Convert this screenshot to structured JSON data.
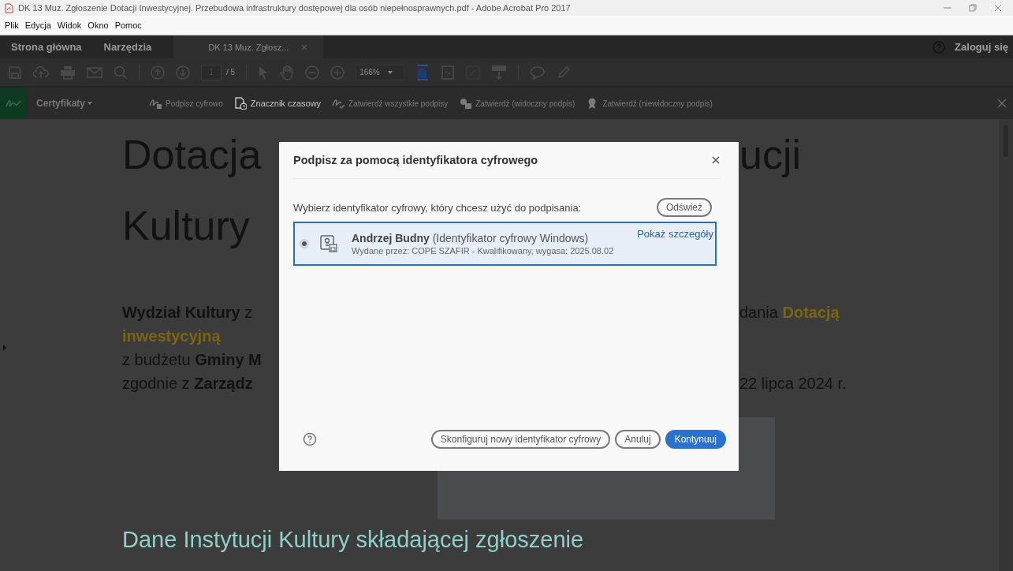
{
  "window": {
    "title": "DK 13 Muz. Zgłoszenie Dotacji Inwestycyjnej. Przebudowa infrastruktury dostępowej dla osób niepełnosprawnych.pdf - Adobe Acrobat Pro 2017"
  },
  "menu": [
    {
      "label": "Plik"
    },
    {
      "label": "Edycja"
    },
    {
      "label": "Widok"
    },
    {
      "label": "Okno"
    },
    {
      "label": "Pomoc"
    }
  ],
  "tabs": [
    {
      "label": "Strona główna",
      "selected": false
    },
    {
      "label": "Narzędzia",
      "selected": false
    },
    {
      "label": "DK 13 Muz. Zgłosz...",
      "selected": true
    }
  ],
  "sign_in": "Zaloguj się",
  "toolbar": {
    "page": "1",
    "page_total": "/ 5",
    "zoom": "166%"
  },
  "cert_toolbar": {
    "title": "Certyfikaty",
    "items": [
      {
        "label": "Podpisz cyfrowo",
        "disabled": true
      },
      {
        "label": "Znacznik czasowy",
        "disabled": false
      },
      {
        "label": "Zatwierdź wszystkie podpisy",
        "disabled": true
      },
      {
        "label": "Zatwierdź (widoczny podpis)",
        "disabled": true
      },
      {
        "label": "Zatwierdź (niewidoczny podpis)",
        "disabled": true
      }
    ]
  },
  "document": {
    "title_lines": [
      {
        "left": "Dotacja",
        "right": "ucji"
      },
      {
        "left": "Kultury"
      }
    ],
    "paragraph_lines": [
      {
        "left": [
          {
            "text": "Wydział Kultury",
            "kind": "bold"
          },
          {
            "text": " z",
            "kind": "plain"
          }
        ],
        "right": [
          {
            "text": "dania ",
            "kind": "plain"
          },
          {
            "text": "Dotacją",
            "kind": "accent"
          }
        ]
      },
      {
        "left": [
          {
            "text": "inwestycyjną",
            "kind": "accent"
          }
        ]
      },
      {
        "left": [
          {
            "text": "z budżetu ",
            "kind": "plain"
          },
          {
            "text": "Gminy M",
            "kind": "bold"
          }
        ]
      },
      {
        "left": [
          {
            "text": "zgodnie z ",
            "kind": "plain"
          },
          {
            "text": "Zarządz",
            "kind": "bold"
          }
        ],
        "right": [
          {
            "text": "22 lipca 2024 r.",
            "kind": "plain"
          }
        ]
      }
    ],
    "section_heading": "Dane Instytucji Kultury składającej zgłoszenie"
  },
  "dialog": {
    "title": "Podpisz za pomocą identyfikatora cyfrowego",
    "prompt": "Wybierz identyfikator cyfrowy, który chcesz użyć do podpisania:",
    "refresh": "Odśwież",
    "identities": [
      {
        "name": "**Andrzej Budny** (Identyfikator cyfrowy Windows)",
        "issuer": "Wydane przez: COPE SZAFIR - Kwalifikowany, wygasa: 2025.08.02",
        "details": "Pokaż szczegóły",
        "selected": true
      }
    ],
    "buttons": [
      {
        "label": "Skonfiguruj nowy identyfikator cyfrowy",
        "kind": "outline"
      },
      {
        "label": "Anuluj",
        "kind": "outline"
      },
      {
        "label": "Kontynuuj",
        "kind": "primary"
      }
    ]
  }
}
